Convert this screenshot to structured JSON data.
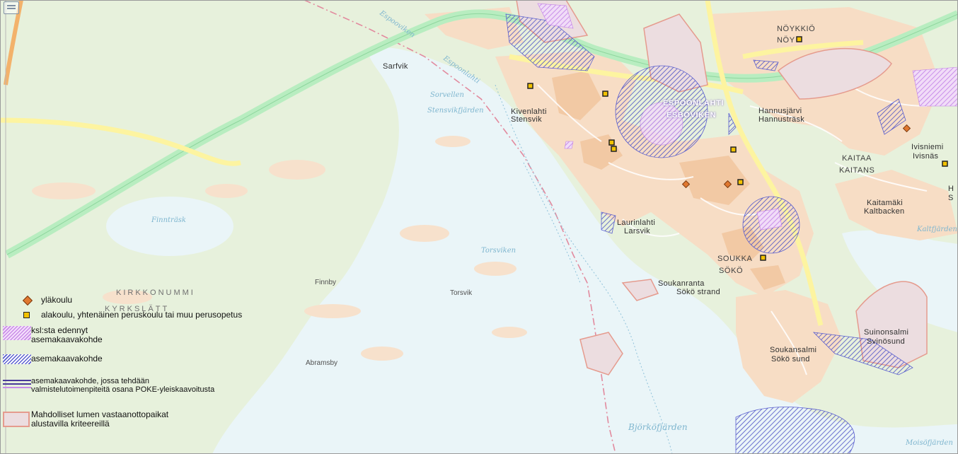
{
  "map": {
    "colors": {
      "land": "#e7f1dc",
      "water": "#eaf5f8",
      "urban": "#f7ddc5",
      "urban_dense": "#f2c9a4",
      "main_road": "#fdf4a0",
      "highway": "#b8edc0",
      "school_diamond": "#e07830",
      "school_square": "#f2c200",
      "hatch_blue": "#5a5fcf",
      "hatch_pink": "#c98be8",
      "snow_site_border": "#e59b8e",
      "snow_site_fill": "#ecdde0",
      "boundary": "#e28a9e"
    },
    "corner_icon": "layers-icon",
    "place_labels": {
      "sarfvik": "Sarfvik",
      "noykkio": "NÖYKKIÖ",
      "noykkio2": "NÖY",
      "espoonlahti": "ESPOONLAHTI",
      "esboviken": "ESBOVIKEN",
      "kivenlahti": "Kivenlahti",
      "stensvik": "Stensvik",
      "hannusjarvi": "Hannusjärvi",
      "hannustrask": "Hannusträsk",
      "kaitaa": "KAITAA",
      "kaitans": "KAITANS",
      "ivisniemi": "Ivisniemi",
      "ivisnas": "Ivisnäs",
      "kaitamaki": "Kaitamäki",
      "kaltbacken": "Kaltbacken",
      "laurinlahti": "Laurinlahti",
      "larsvik": "Larsvik",
      "soukka": "SOUKKA",
      "soko": "SÖKÖ",
      "soukanranta": "Soukanranta",
      "soko_strand": "Sökö strand",
      "soukansalmi": "Soukansalmi",
      "soko_sund": "Sökö sund",
      "suinonsalmi": "Suinonsalmi",
      "svinosund": "Svinösund",
      "finnby": "Finnby",
      "torsvik": "Torsvik",
      "abramsby": "Abramsby",
      "kirkkonummi": "KIRKKONUMMI",
      "kyrkslatt": "KYRKSLÄTT",
      "h": "H",
      "s": "S"
    },
    "water_labels": {
      "stensvikfjarden": "Stensvikfjärden",
      "finntrask": "Finnträsk",
      "bjorkofjarden": "Björköfjärden",
      "moisofjarden": "Moisöfjärden",
      "kaltfjarden": "Kaltfjärden",
      "espoonlahti_water": "Espoonlahti",
      "espooviken": "Espooviken",
      "sorvellen": "Sorvellen",
      "torsviken": "Torsviken"
    }
  },
  "legend": {
    "items": [
      {
        "icon": "diamond-icon",
        "label": "yläkoulu"
      },
      {
        "icon": "square-icon",
        "label": "alakoulu, yhtenäinen peruskoulu tai muu perusopetus"
      },
      {
        "icon": "pink-hatch-swatch",
        "label": "ksl:sta edennyt asemakaavakohde"
      },
      {
        "icon": "blue-hatch-swatch",
        "label": "asemakaavakohde"
      },
      {
        "icon": "lines-swatch",
        "label": "asemakaavakohde, jossa tehdään valmistelutoimenpiteitä osana POKE-yleiskaavoitusta"
      },
      {
        "icon": "snow-site-swatch",
        "label": "Mahdolliset lumen vastaanottopaikat alustavilla kriteereillä"
      }
    ]
  }
}
